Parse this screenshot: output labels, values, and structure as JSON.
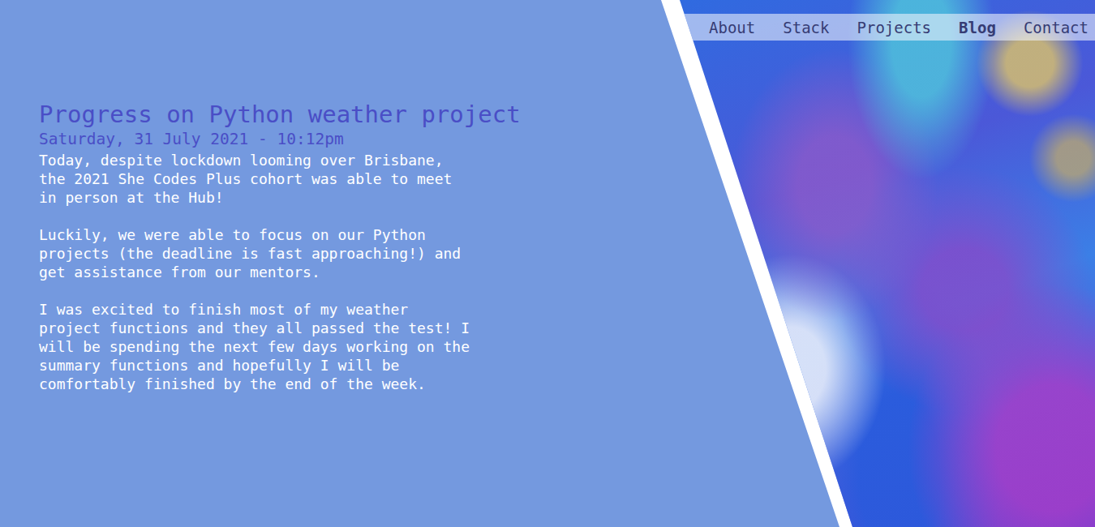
{
  "nav": {
    "items": [
      {
        "label": "About",
        "selected": false
      },
      {
        "label": "Stack",
        "selected": false
      },
      {
        "label": "Projects",
        "selected": false
      },
      {
        "label": "Blog",
        "selected": true
      },
      {
        "label": "Contact",
        "selected": false
      }
    ]
  },
  "post": {
    "title": "Progress on Python weather project",
    "date": "Saturday, 31 July 2021 - 10:12pm",
    "paragraphs": [
      "Today, despite lockdown looming over Brisbane, the 2021 She Codes Plus cohort was able to meet in person at the Hub!",
      "Luckily, we were able to focus on our Python projects (the deadline is fast approaching!) and get assistance from our mentors.",
      "I was excited to finish most of my weather project functions and they all passed the test! I will be spending the next few days working on the summary functions and hopefully I will be comfortably finished by the end of the week."
    ]
  }
}
